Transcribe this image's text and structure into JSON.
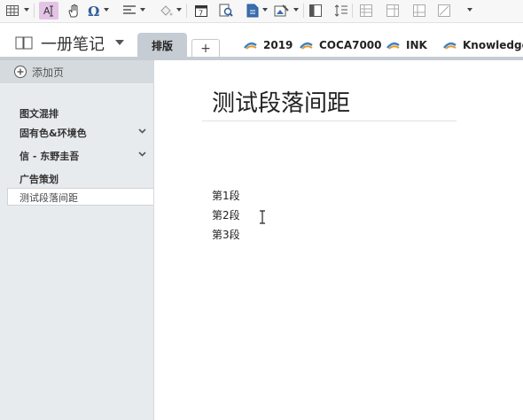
{
  "toolbar": {
    "icons": [
      "table-icon",
      "format-painter-icon",
      "hand-icon",
      "symbol-icon",
      "align-icon",
      "fill-icon",
      "calendar-icon",
      "find-icon",
      "page-icon",
      "ink-image-icon",
      "view-icon",
      "line-spacing-icon",
      "grid-icon",
      "grid-icon",
      "grid-icon",
      "draw-icon",
      "more-icon"
    ]
  },
  "navbar": {
    "notebook_title": "一册笔记",
    "active_tab": "排版",
    "add_tab": "+",
    "tabs": [
      {
        "label": "2019"
      },
      {
        "label": "COCA7000"
      },
      {
        "label": "INK"
      },
      {
        "label": "Knowledge"
      }
    ]
  },
  "sidebar": {
    "add_page": "添加页",
    "items": [
      {
        "label": "图文混排"
      },
      {
        "label": "固有色&环境色"
      },
      {
        "label": "信 - 东野圭吾"
      },
      {
        "label": "广告策划"
      }
    ],
    "selected_item": "测试段落间距"
  },
  "page": {
    "title": "测试段落间距",
    "paragraphs": [
      "第1段",
      "第2段",
      "第3段"
    ]
  },
  "colors": {
    "tab_active": "#c6ccd3",
    "sidebar_bg": "#e8ebee",
    "section_icon_blue": "#3c7fc4",
    "section_icon_orange": "#e39a2a"
  }
}
